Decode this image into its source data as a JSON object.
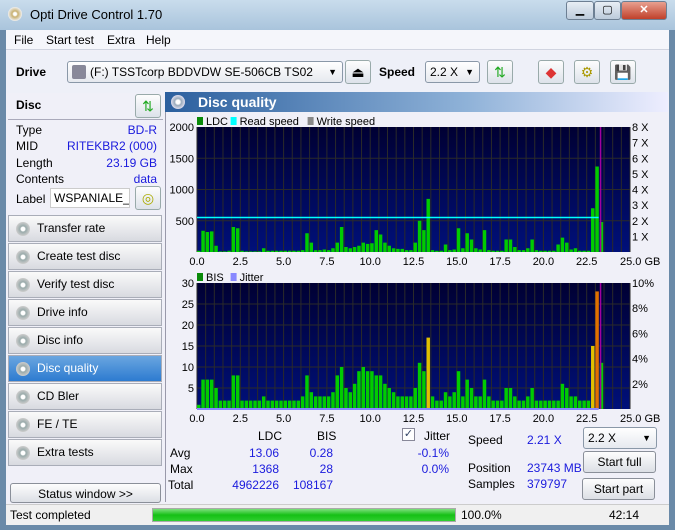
{
  "app": {
    "title": "Opti Drive Control 1.70"
  },
  "menu": [
    "File",
    "Start test",
    "Extra",
    "Help"
  ],
  "toolbar": {
    "drive_label": "Drive",
    "drive_value": "(F:)   TSSTcorp BDDVDW SE-506CB TS02",
    "speed_label": "Speed",
    "speed_value": "2.2 X"
  },
  "disc": {
    "header": "Disc",
    "type_label": "Type",
    "type": "BD-R",
    "mid_label": "MID",
    "mid": "RITEKBR2 (000)",
    "length_label": "Length",
    "length": "23.19 GB",
    "contents_label": "Contents",
    "contents": "data",
    "label_label": "Label",
    "label": "WSPANIALE_ST"
  },
  "sidebar": [
    {
      "label": "Transfer rate"
    },
    {
      "label": "Create test disc"
    },
    {
      "label": "Verify test disc"
    },
    {
      "label": "Drive info"
    },
    {
      "label": "Disc info"
    },
    {
      "label": "Disc quality",
      "selected": true
    },
    {
      "label": "CD Bler"
    },
    {
      "label": "FE / TE"
    },
    {
      "label": "Extra tests"
    }
  ],
  "status_window_button": "Status window >>",
  "panel_title": "Disc quality",
  "colors": {
    "plot_top": "#000033",
    "plot_bottom": "#00107a",
    "ldc": "#00cc00",
    "read_speed": "#00ffff",
    "bis_high": "#e0c000",
    "marker": "#a000a0"
  },
  "chart_data": [
    {
      "type": "bar",
      "legend": [
        "LDC",
        "Read speed",
        "Write speed"
      ],
      "xlim": [
        0,
        25
      ],
      "ylim": [
        0,
        2000
      ],
      "y2lim": [
        0,
        8
      ],
      "xticks": [
        "0.0",
        "2.5",
        "5.0",
        "7.5",
        "10.0",
        "12.5",
        "15.0",
        "17.5",
        "20.0",
        "22.5",
        "25.0 GB"
      ],
      "yticks": [
        "2000",
        "1500",
        "1000",
        "500"
      ],
      "y2ticks": [
        "8 X",
        "7 X",
        "6 X",
        "5 X",
        "4 X",
        "3 X",
        "2 X",
        "1 X"
      ],
      "x_step_gb": 0.25,
      "ldc": [
        20,
        340,
        320,
        330,
        100,
        10,
        10,
        20,
        400,
        380,
        20,
        10,
        10,
        10,
        10,
        60,
        20,
        20,
        20,
        20,
        20,
        20,
        20,
        20,
        30,
        300,
        150,
        30,
        30,
        40,
        30,
        60,
        150,
        400,
        80,
        60,
        80,
        100,
        150,
        130,
        140,
        350,
        280,
        150,
        100,
        60,
        50,
        50,
        30,
        30,
        150,
        500,
        350,
        850,
        30,
        20,
        20,
        120,
        30,
        40,
        380,
        60,
        300,
        200,
        60,
        40,
        350,
        30,
        20,
        20,
        20,
        200,
        200,
        80,
        30,
        30,
        60,
        200,
        30,
        20,
        20,
        20,
        20,
        120,
        230,
        150,
        40,
        60,
        20,
        20,
        20,
        700,
        1368,
        480
      ],
      "read_speed_x": 2.21,
      "read_speed_end_gb": 23.19,
      "marker_gb": 23.3
    },
    {
      "type": "bar",
      "legend": [
        "BIS",
        "Jitter"
      ],
      "xlim": [
        0,
        25
      ],
      "ylim": [
        0,
        30
      ],
      "y2lim": [
        0,
        10
      ],
      "xticks": [
        "0.0",
        "2.5",
        "5.0",
        "7.5",
        "10.0",
        "12.5",
        "15.0",
        "17.5",
        "20.0",
        "22.5",
        "25.0 GB"
      ],
      "yticks": [
        "30",
        "25",
        "20",
        "15",
        "10",
        "5"
      ],
      "y2ticks": [
        "10%",
        "8%",
        "6%",
        "4%",
        "2%"
      ],
      "x_step_gb": 0.25,
      "bis": [
        1,
        7,
        7,
        7,
        5,
        2,
        2,
        2,
        8,
        8,
        2,
        2,
        2,
        2,
        2,
        3,
        2,
        2,
        2,
        2,
        2,
        2,
        2,
        2,
        3,
        8,
        4,
        3,
        3,
        3,
        3,
        4,
        8,
        10,
        5,
        4,
        6,
        9,
        10,
        9,
        9,
        8,
        8,
        6,
        5,
        4,
        3,
        3,
        3,
        3,
        5,
        11,
        9,
        17,
        3,
        2,
        2,
        4,
        3,
        4,
        9,
        3,
        7,
        5,
        3,
        3,
        7,
        3,
        2,
        2,
        2,
        5,
        5,
        3,
        2,
        2,
        3,
        5,
        2,
        2,
        2,
        2,
        2,
        2,
        6,
        5,
        3,
        3,
        2,
        2,
        2,
        15,
        28,
        11
      ],
      "marker_gb": 23.3
    }
  ],
  "stats": {
    "col_ldc": "LDC",
    "col_bis": "BIS",
    "avg_label": "Avg",
    "max_label": "Max",
    "total_label": "Total",
    "avg_ldc": "13.06",
    "avg_bis": "0.28",
    "max_ldc": "1368",
    "max_bis": "28",
    "total_ldc": "4962226",
    "total_bis": "108167",
    "jitter_label": "Jitter",
    "jitter_checked": true,
    "jitter_avg": "-0.1%",
    "jitter_max": "0.0%",
    "speed_label": "Speed",
    "speed": "2.21 X",
    "position_label": "Position",
    "position": "23743 MB",
    "samples_label": "Samples",
    "samples": "379797",
    "speed_select": "2.2 X",
    "start_full": "Start full",
    "start_part": "Start part"
  },
  "statusbar": {
    "text": "Test completed",
    "progress_percent": 100,
    "progress_text": "100.0%",
    "time": "42:14"
  }
}
